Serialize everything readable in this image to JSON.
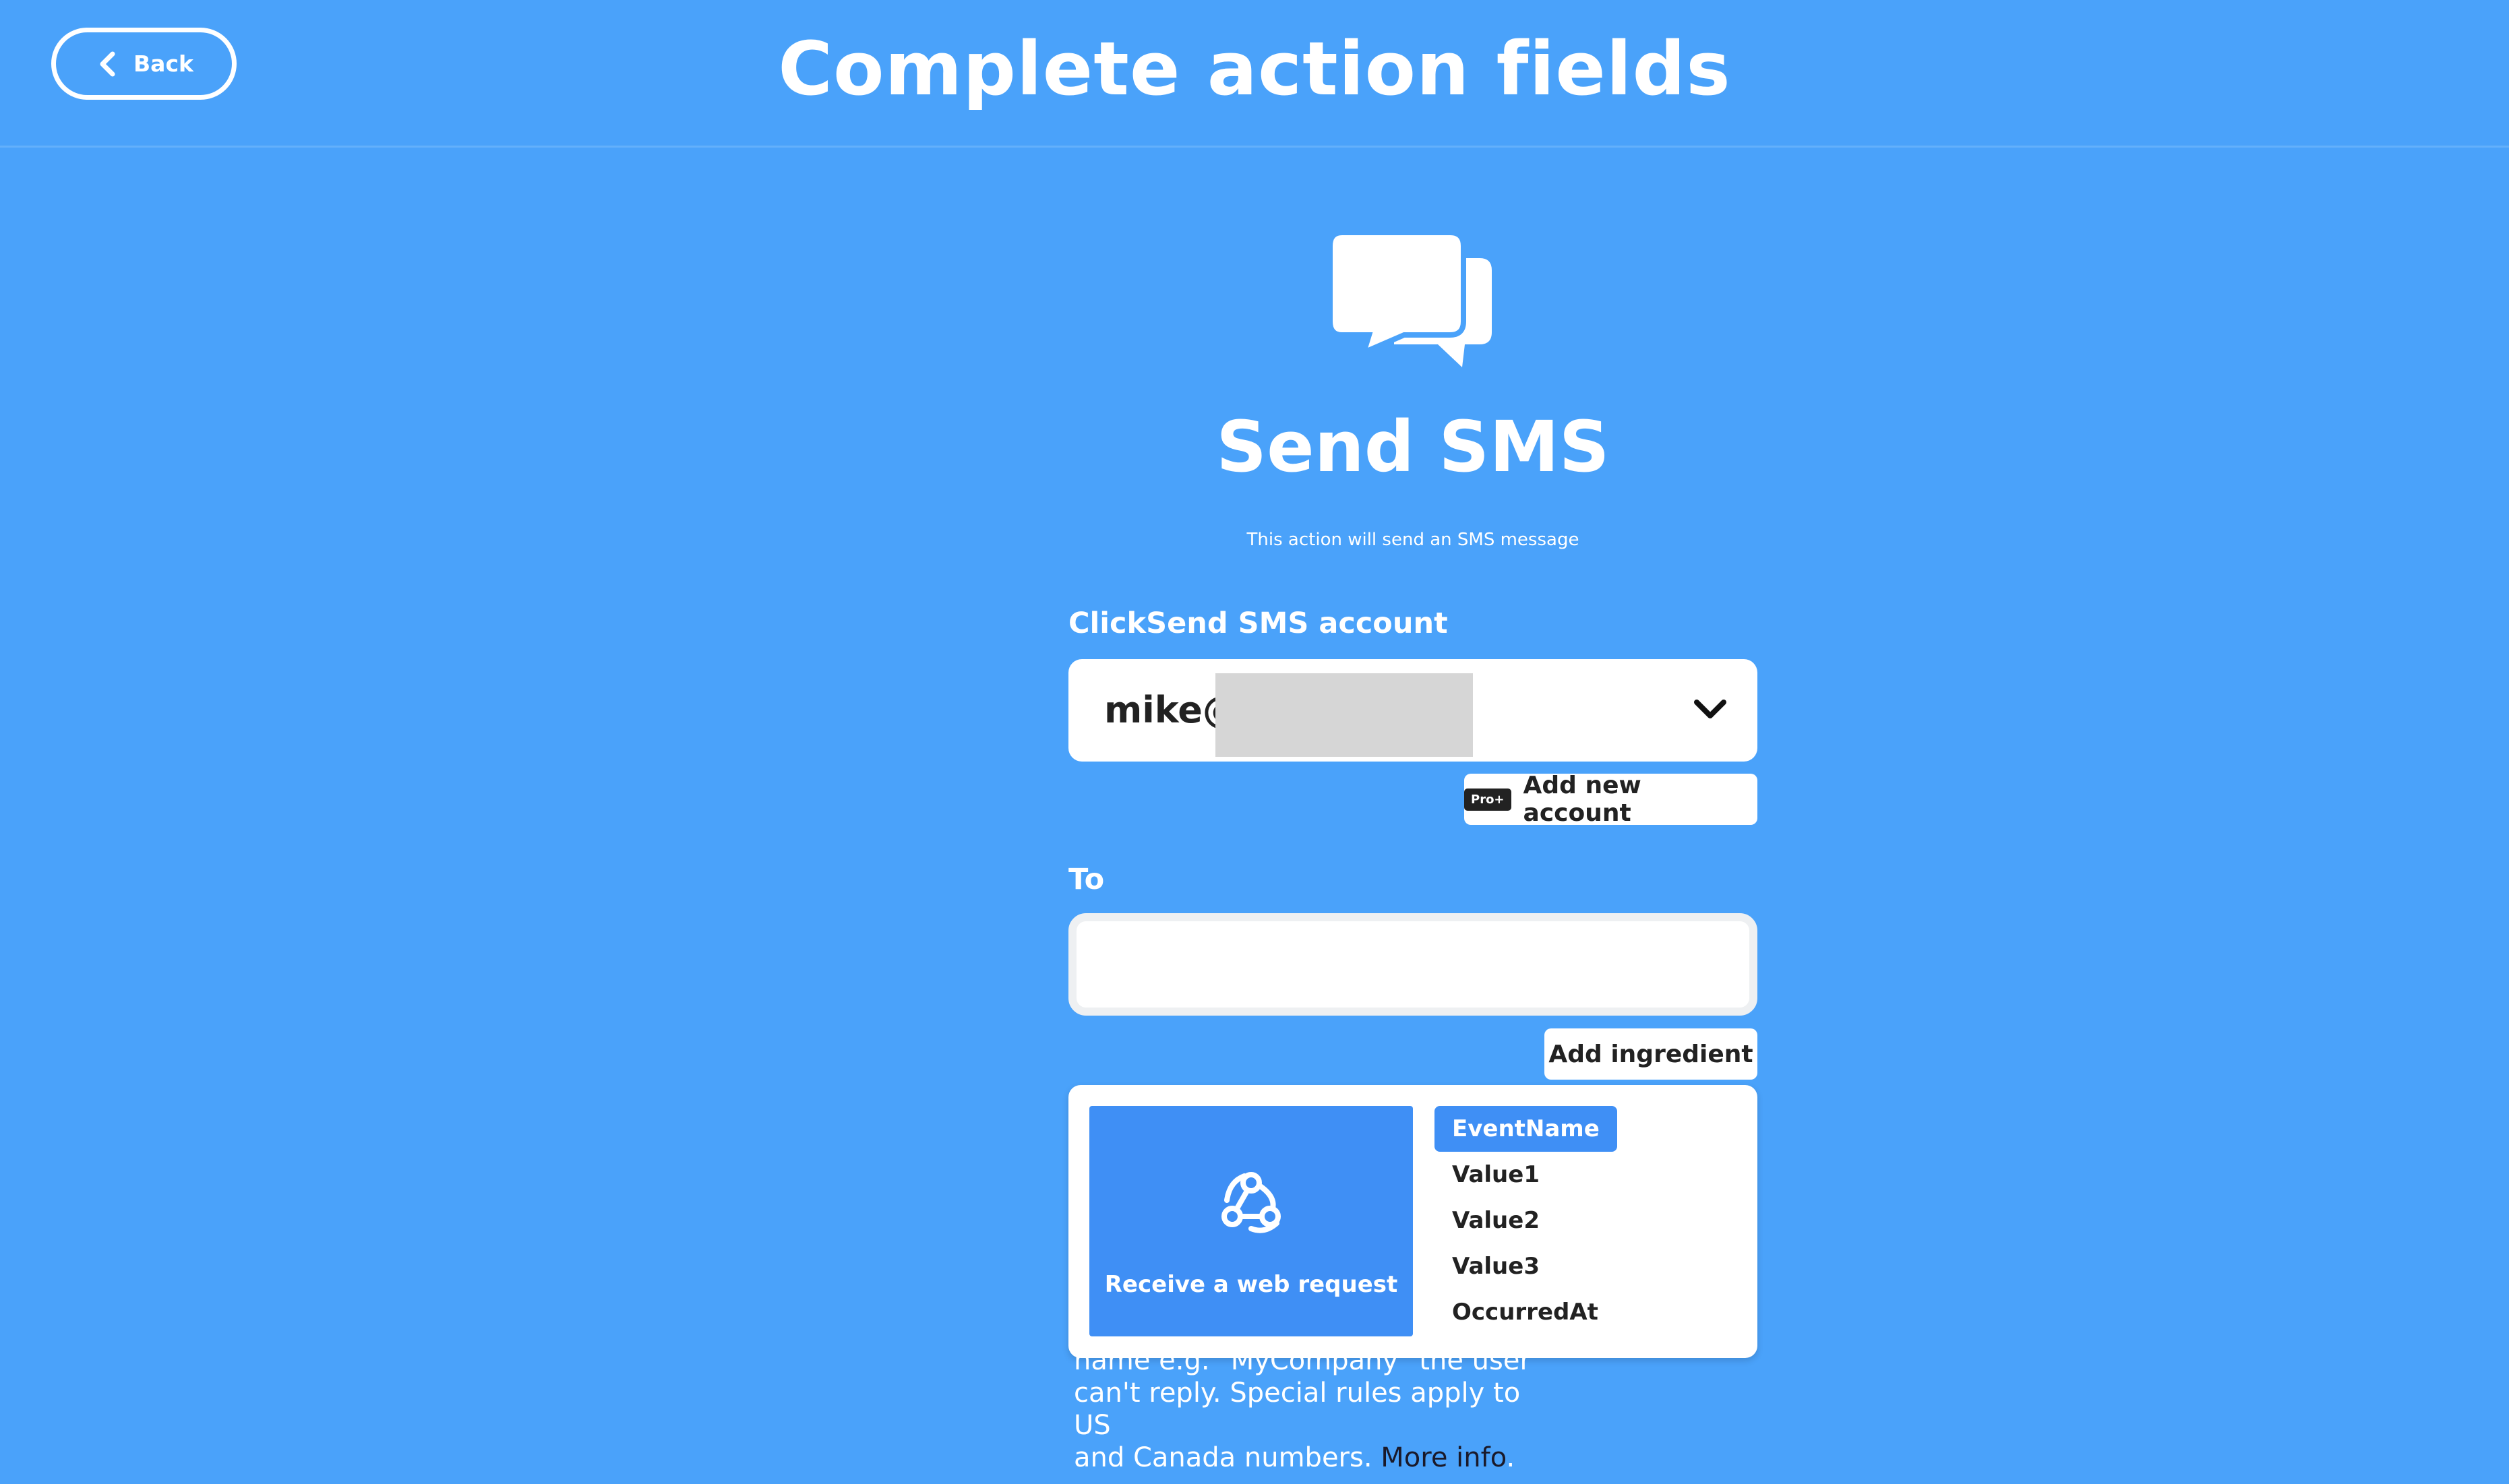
{
  "header": {
    "back_label": "Back",
    "title": "Complete action fields"
  },
  "action": {
    "icon": "chat-bubbles-icon",
    "title": "Send SMS",
    "description": "This action will send an SMS message"
  },
  "account_field": {
    "label": "ClickSend SMS account",
    "value": "mike@",
    "add_button_badge": "Pro+",
    "add_button_label": "Add new account"
  },
  "to_field": {
    "label": "To",
    "value": "",
    "add_ingredient_label": "Add ingredient"
  },
  "ingredients": {
    "trigger_icon": "webhook-icon",
    "trigger_label": "Receive a web request",
    "items": [
      {
        "label": "EventName",
        "selected": true
      },
      {
        "label": "Value1",
        "selected": false
      },
      {
        "label": "Value2",
        "selected": false
      },
      {
        "label": "Value3",
        "selected": false
      },
      {
        "label": "OccurredAt",
        "selected": false
      }
    ]
  },
  "help": {
    "text_line1": "name e.g. \"MyCompany\" the user",
    "text_line2": "can't reply. Special rules apply to US",
    "text_line3": "and Canada numbers. ",
    "more_info": "More info",
    "trailing": "."
  },
  "colors": {
    "background": "#4aa2fa",
    "accent": "#3f8ff5"
  }
}
